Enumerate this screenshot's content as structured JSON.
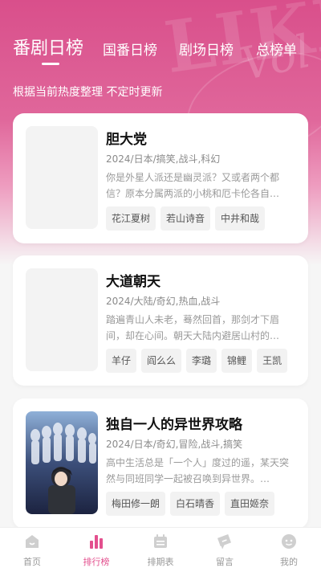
{
  "header": {
    "tabs": [
      {
        "label": "番剧日榜"
      },
      {
        "label": "国番日榜"
      },
      {
        "label": "剧场日榜"
      },
      {
        "label": "总榜单"
      }
    ],
    "subtitle": "根据当前热度整理 不定时更新"
  },
  "cards": [
    {
      "title": "胆大党",
      "meta": "2024/日本/搞笑,战斗,科幻",
      "desc": "你是外星人派还是幽灵派？又或者两个都信？原本分属两派的小桃和厄卡伦各自…",
      "tags": [
        "花江夏树",
        "若山诗音",
        "中井和哉"
      ]
    },
    {
      "title": "大道朝天",
      "meta": "2024/大陆/奇幻,热血,战斗",
      "desc": "踏遍青山人未老，蓦然回首，那剑才下眉间，却在心间。朝天大陆内避居山村的…",
      "tags": [
        "羊仔",
        "阎么么",
        "李璐",
        "锦鲤",
        "王凯"
      ]
    },
    {
      "title": "独自一人的异世界攻略",
      "meta": "2024/日本/奇幻,冒险,战斗,搞笑",
      "desc": "高中生活总是「一个人」度过的遥，某天突然与同班同学一起被召唤到异世界。…",
      "tags": [
        "梅田修一朗",
        "白石晴香",
        "直田姬奈"
      ]
    }
  ],
  "nav": [
    {
      "label": "首页",
      "icon": "home-icon"
    },
    {
      "label": "排行榜",
      "icon": "ranking-icon"
    },
    {
      "label": "排期表",
      "icon": "calendar-icon"
    },
    {
      "label": "留言",
      "icon": "message-icon"
    },
    {
      "label": "我的",
      "icon": "profile-icon"
    }
  ],
  "colors": {
    "accent": "#e3508e",
    "hero": "#d94f8b"
  }
}
